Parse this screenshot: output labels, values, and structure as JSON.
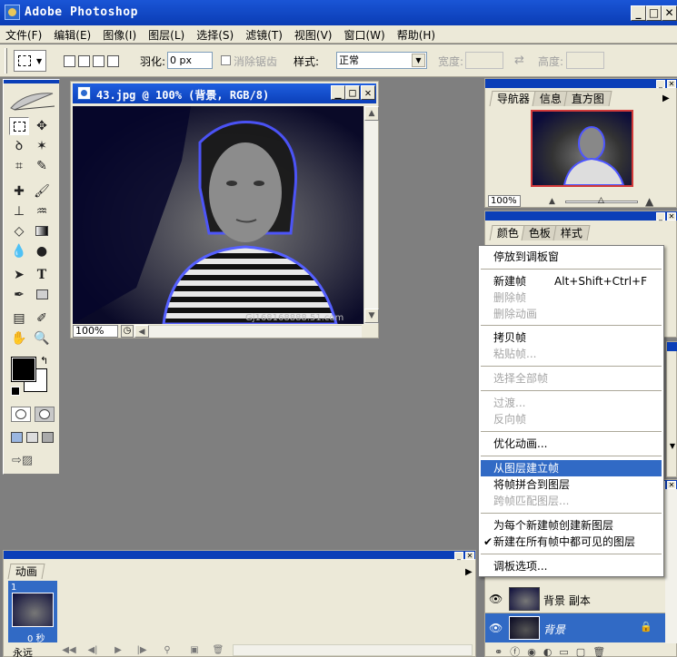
{
  "app": {
    "title": "Adobe Photoshop"
  },
  "menu": [
    "文件(F)",
    "编辑(E)",
    "图像(I)",
    "图层(L)",
    "选择(S)",
    "滤镜(T)",
    "视图(V)",
    "窗口(W)",
    "帮助(H)"
  ],
  "options": {
    "feather_label": "羽化:",
    "feather_value": "0 px",
    "antialias_label": "消除锯齿",
    "style_label": "样式:",
    "style_value": "正常",
    "width_label": "宽度:",
    "height_label": "高度:"
  },
  "document": {
    "title": "43.jpg @ 100% (背景, RGB/8)",
    "zoom": "100%",
    "watermark": "Gj168168888.51.com"
  },
  "navigator": {
    "tabs": [
      "导航器",
      "信息",
      "直方图"
    ],
    "zoom": "100%"
  },
  "color_panel": {
    "tabs": [
      "颜色",
      "色板",
      "样式"
    ]
  },
  "context_menu": {
    "items": [
      {
        "label": "停放到调板窗",
        "enabled": true
      },
      {
        "label": "新建帧",
        "shortcut": "Alt+Shift+Ctrl+F",
        "enabled": true
      },
      {
        "label": "删除帧",
        "enabled": false
      },
      {
        "label": "删除动画",
        "enabled": false
      },
      {
        "label": "拷贝帧",
        "enabled": true
      },
      {
        "label": "粘贴帧...",
        "enabled": false
      },
      {
        "label": "选择全部帧",
        "enabled": false
      },
      {
        "label": "过渡...",
        "enabled": false
      },
      {
        "label": "反向帧",
        "enabled": false
      },
      {
        "label": "优化动画...",
        "enabled": true
      },
      {
        "label": "从图层建立帧",
        "enabled": true,
        "highlighted": true
      },
      {
        "label": "将帧拼合到图层",
        "enabled": true
      },
      {
        "label": "跨帧匹配图层...",
        "enabled": false
      },
      {
        "label": "为每个新建帧创建新图层",
        "enabled": true
      },
      {
        "label": "新建在所有帧中都可见的图层",
        "enabled": true,
        "checked": true
      },
      {
        "label": "调板选项...",
        "enabled": true
      }
    ],
    "check_mark": "✔"
  },
  "layers": {
    "rows": [
      {
        "name": "背景 副本",
        "selected": false
      },
      {
        "name": "背景",
        "selected": true
      }
    ]
  },
  "animation": {
    "tab": "动画",
    "frame_number": "1",
    "frame_delay": "0 秒",
    "loop": "永远"
  },
  "colors": {
    "title_blue": "#0b3fb8",
    "highlight": "#316ac5",
    "panel_bg": "#ece9d8",
    "workspace": "#7f7f7f"
  }
}
